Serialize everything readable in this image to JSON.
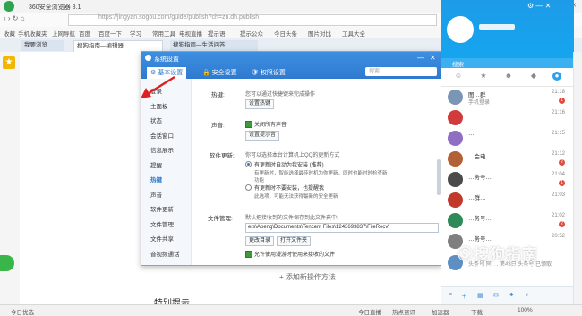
{
  "browser": {
    "title": "360安全浏览器 8.1",
    "url": "https://jingyan.sogou.com/guide/publish?ch=zn.dh.publish",
    "bookmarks": [
      "收藏",
      "手机收藏夹",
      "上网导航",
      "百度",
      "百度一下",
      "学习",
      "常用工具",
      "电视直播",
      "提示语",
      "提示公众",
      "今日头条",
      "图片对比",
      "工具大全"
    ],
    "tabs": [
      {
        "label": "我要浏览"
      },
      {
        "label": "搜狗指南—编辑器"
      },
      {
        "label": "搜狗指南—生活问答"
      }
    ],
    "page_add": "+ 添加新操作方法",
    "page_tip": "特别提示",
    "status_left": "今日优选",
    "status_items": [
      "今日直播",
      "热点资讯",
      "加速器",
      "下载",
      "100%"
    ]
  },
  "dialog": {
    "title": "系统设置",
    "tabs": [
      "基本设置",
      "安全设置",
      "权限设置"
    ],
    "search_placeholder": "搜索",
    "nav": [
      "登录",
      "主面板",
      "状态",
      "会话窗口",
      "信息展示",
      "提醒",
      "热键",
      "声音",
      "软件更新",
      "文件管理",
      "文件共享",
      "音视频通话"
    ],
    "hotkey_label": "热键:",
    "hotkey_desc": "您可以通过快捷键来完成操作",
    "hotkey_button": "设置热键",
    "sound_label": "声音:",
    "sound_check": "关闭所有声音",
    "sound_button": "设置提示音",
    "update_label": "软件更新:",
    "update_desc": "你可以选择本台计算机上QQ的更新方式",
    "update_opt1": "有更新时自动为我安装 (推荐)",
    "update_opt1_desc": "有更新时，智能选择最佳时机为你更新，同时也能时时检查新功能",
    "update_opt2": "有更新时不要安装，也提醒我",
    "update_opt2_desc": "此选项，可能无法获得最新的安全更新",
    "file_label": "文件管理:",
    "file_desc": "默认把接收到的文件保存到此文件夹中:",
    "file_path": "ers\\Apeng\\Documents\\Tencent Files\\1243693837\\FileRecv\\",
    "file_btn1": "更改目录",
    "file_btn2": "打开文件夹",
    "file_check": "允许使用漫游时使用来接收的文件"
  },
  "qq": {
    "search_placeholder": "搜索",
    "rows": [
      {
        "name": "图…群",
        "msg": "手机登录",
        "time": "21:18",
        "badge": "1",
        "color": "#7a95b5"
      },
      {
        "name": "",
        "msg": "",
        "time": "21:16",
        "badge": "",
        "color": "#d13b3b"
      },
      {
        "name": "…",
        "msg": "",
        "time": "21:15",
        "badge": "",
        "color": "#8f6fc1"
      },
      {
        "name": "…会电…",
        "msg": "",
        "time": "21:12",
        "badge": "2",
        "color": "#b26036"
      },
      {
        "name": "…务号…",
        "msg": "",
        "time": "21:04",
        "badge": "1",
        "color": "#4b4b4b"
      },
      {
        "name": "…群…",
        "msg": "",
        "time": "21:03",
        "badge": "",
        "color": "#c0392b"
      },
      {
        "name": "…务号…",
        "msg": "",
        "time": "21:02",
        "badge": "2",
        "color": "#2e8b57"
      },
      {
        "name": "…务号…",
        "msg": "",
        "time": "20:52",
        "badge": "",
        "color": "#7f7f7f"
      }
    ],
    "last_msg": "头条号 同 … 第48日 头条号 已领取"
  },
  "watermark": "搜狗指南",
  "watermark_sub": "zhinan.sogou.com",
  "colors": {
    "accent": "#2f7ad0",
    "qq_blue": "#1e9be8",
    "badge": "#e24a3c"
  }
}
